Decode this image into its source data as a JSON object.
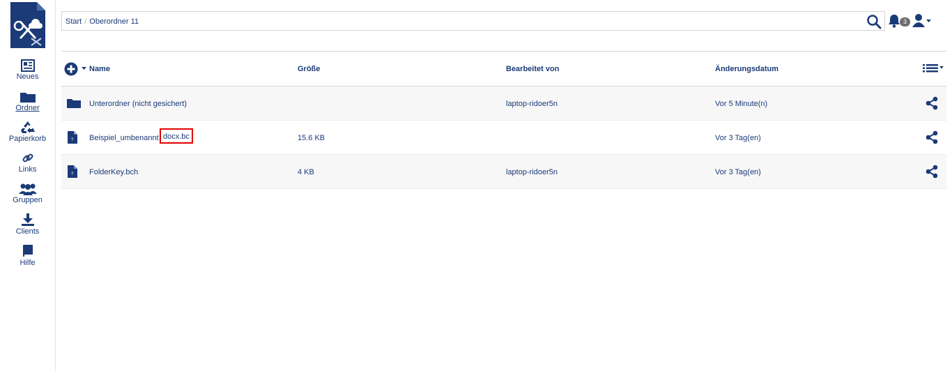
{
  "sidebar": {
    "items": [
      {
        "label": "Neues",
        "icon": "newspaper-icon"
      },
      {
        "label": "Ordner",
        "icon": "folder-icon"
      },
      {
        "label": "Papierkorb",
        "icon": "recycle-icon"
      },
      {
        "label": "Links",
        "icon": "link-icon"
      },
      {
        "label": "Gruppen",
        "icon": "users-icon"
      },
      {
        "label": "Clients",
        "icon": "download-icon"
      },
      {
        "label": "Hilfe",
        "icon": "book-icon"
      }
    ],
    "active": "Ordner"
  },
  "breadcrumb": {
    "items": [
      "Start",
      "Oberordner 11"
    ],
    "separator": "/"
  },
  "notifications": {
    "count": "3"
  },
  "table": {
    "headers": {
      "name": "Name",
      "size": "Größe",
      "edited_by": "Bearbeitet von",
      "modified": "Änderungsdatum"
    },
    "rows": [
      {
        "name": "Unterordner (nicht gesichert)",
        "size": "",
        "edited_by": "laptop-ridoer5n",
        "modified": "Vor 5 Minute(n)",
        "icon": "folder-icon"
      },
      {
        "name": "Beispiel_umbenannt",
        "name_highlight": "docx.bc",
        "size": "15.6 KB",
        "edited_by": "",
        "modified": "Vor 3 Tag(en)",
        "icon": "file-icon"
      },
      {
        "name": "FolderKey.bch",
        "size": "4 KB",
        "edited_by": "laptop-ridoer5n",
        "modified": "Vor 3 Tag(en)",
        "icon": "file-icon"
      }
    ]
  },
  "colors": {
    "primary": "#1b3a78",
    "highlight": "#e00000",
    "row_alt": "#f7f7f7"
  }
}
